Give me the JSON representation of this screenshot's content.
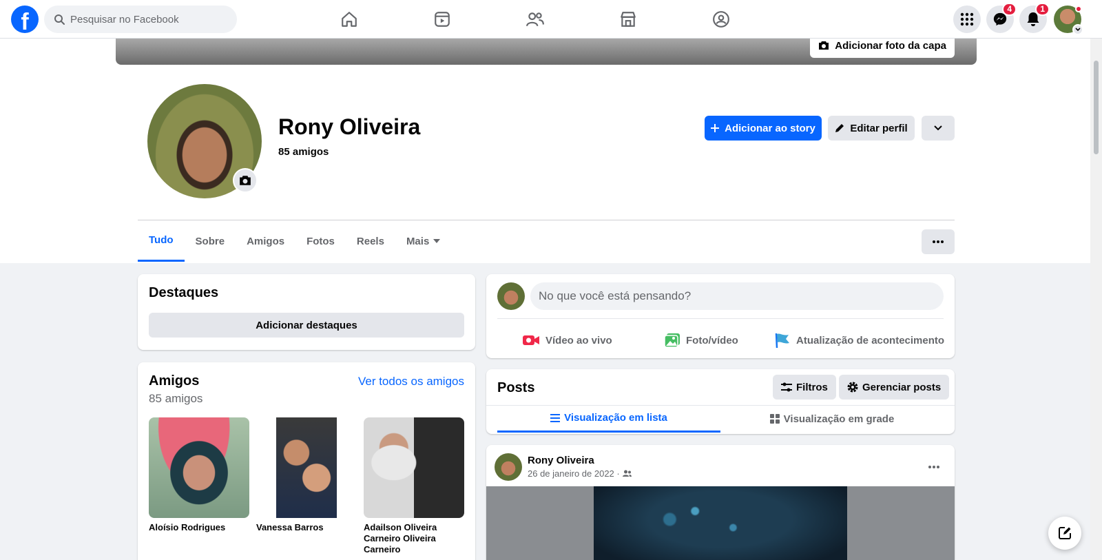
{
  "topbar": {
    "logo": "f",
    "search_placeholder": "Pesquisar no Facebook",
    "nav_icons": [
      "home-icon",
      "video-icon",
      "friends-icon",
      "marketplace-icon",
      "groups-icon"
    ],
    "messenger_badge": "4",
    "notifications_badge": "1"
  },
  "cover": {
    "add_cover_label": "Adicionar foto da capa"
  },
  "profile": {
    "name": "Rony Oliveira",
    "friends_count": "85 amigos",
    "add_story_label": "Adicionar ao story",
    "edit_profile_label": "Editar perfil"
  },
  "tabs": [
    {
      "label": "Tudo",
      "active": true
    },
    {
      "label": "Sobre"
    },
    {
      "label": "Amigos"
    },
    {
      "label": "Fotos"
    },
    {
      "label": "Reels"
    },
    {
      "label": "Mais"
    }
  ],
  "highlights": {
    "title": "Destaques",
    "add_label": "Adicionar destaques"
  },
  "friends_card": {
    "title": "Amigos",
    "see_all": "Ver todos os amigos",
    "count": "85 amigos",
    "friends": [
      {
        "name": "Aloísio Rodrigues"
      },
      {
        "name": "Vanessa Barros"
      },
      {
        "name": "Adailson Oliveira Carneiro Oliveira Carneiro"
      }
    ]
  },
  "composer": {
    "placeholder": "No que você está pensando?",
    "live_video": "Vídeo ao vivo",
    "photo_video": "Foto/vídeo",
    "life_event": "Atualização de acontecimento"
  },
  "posts_header": {
    "title": "Posts",
    "filters": "Filtros",
    "manage": "Gerenciar posts",
    "list_view": "Visualização em lista",
    "grid_view": "Visualização em grade"
  },
  "post": {
    "author": "Rony Oliveira",
    "date": "26 de janeiro de 2022 ·"
  },
  "colors": {
    "accent": "#0866ff",
    "badge": "#e41e3f",
    "muted": "#65676b"
  }
}
